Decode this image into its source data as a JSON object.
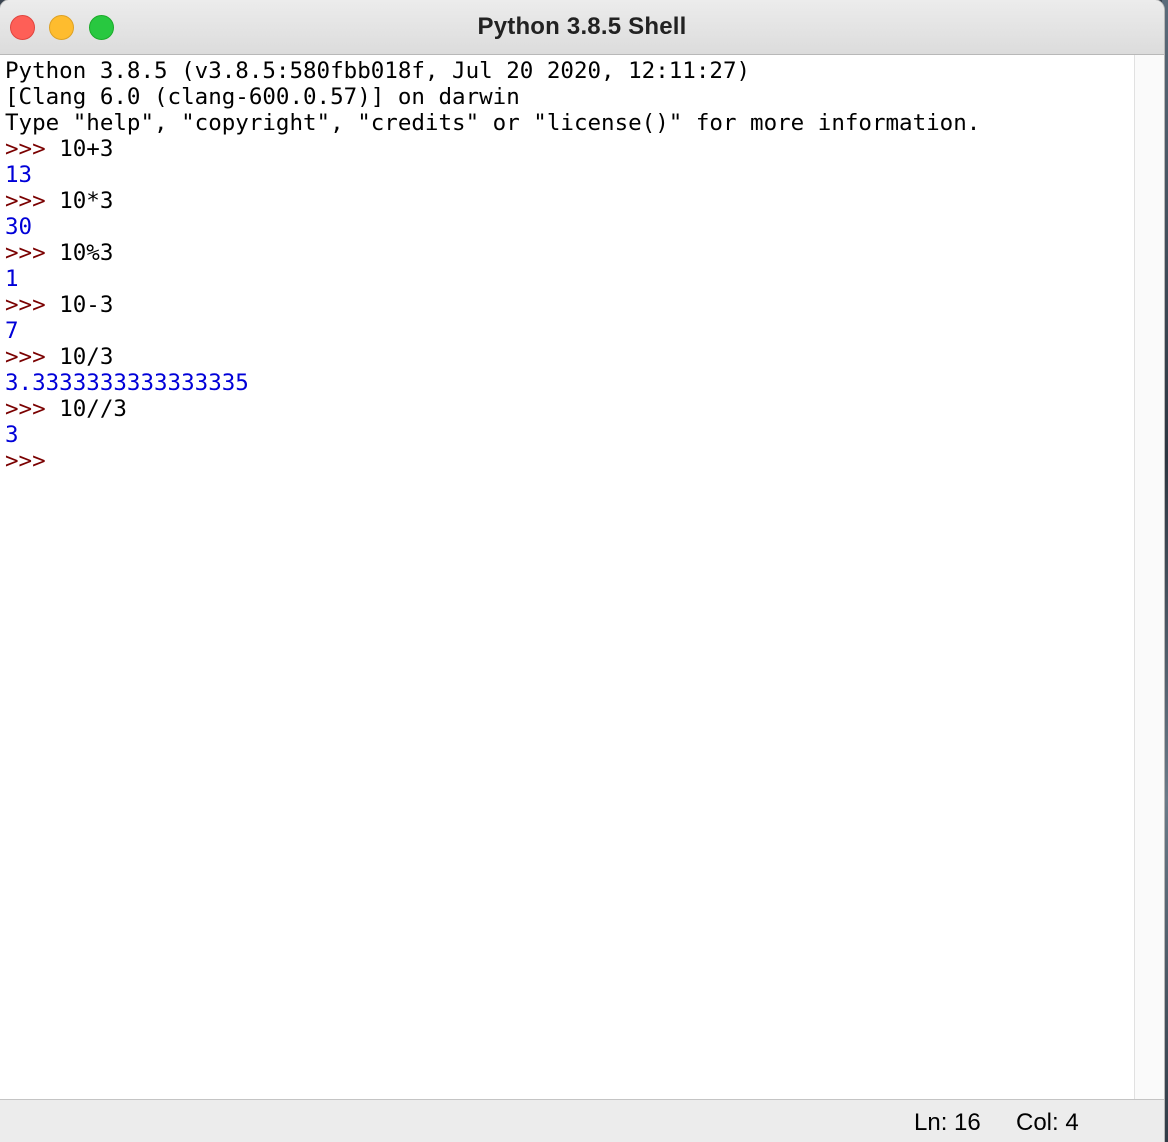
{
  "window": {
    "title": "Python 3.8.5 Shell"
  },
  "shell": {
    "banner": [
      "Python 3.8.5 (v3.8.5:580fbb018f, Jul 20 2020, 12:11:27)",
      "[Clang 6.0 (clang-600.0.57)] on darwin",
      "Type \"help\", \"copyright\", \"credits\" or \"license()\" for more information."
    ],
    "prompt": ">>>",
    "entries": [
      {
        "input": "10+3",
        "output": "13"
      },
      {
        "input": "10*3",
        "output": "30"
      },
      {
        "input": "10%3",
        "output": "1"
      },
      {
        "input": "10-3",
        "output": "7"
      },
      {
        "input": "10/3",
        "output": "3.3333333333333335"
      },
      {
        "input": "10//3",
        "output": "3"
      }
    ],
    "final_prompt": ">>>"
  },
  "status": {
    "ln": "Ln: 16",
    "col": "Col: 4"
  },
  "colors": {
    "prompt": "#7a0000",
    "output": "#0000d8",
    "input": "#000000"
  }
}
